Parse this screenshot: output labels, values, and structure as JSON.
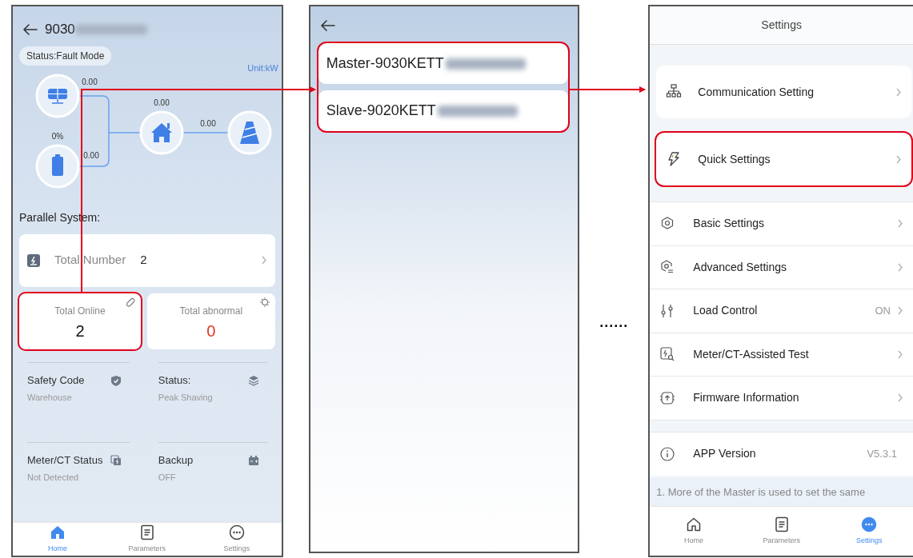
{
  "home_screen": {
    "title": "9030",
    "status": "Status:Fault Mode",
    "unit": "Unit:kW",
    "flow": {
      "solar_power": "0.00",
      "battery_soc": "0%",
      "battery_power": "0.00",
      "home_power": "0.00",
      "grid_power": "0.00"
    },
    "section_title": "Parallel System:",
    "total_number": {
      "label": "Total Number",
      "value": "2"
    },
    "stats": [
      {
        "label": "Total Online",
        "value": "2",
        "alert": false,
        "highlighted": true
      },
      {
        "label": "Total abnormal",
        "value": "0",
        "alert": true,
        "highlighted": false
      }
    ],
    "info": [
      {
        "label": "Safety Code",
        "value": "Warehouse"
      },
      {
        "label": "Status:",
        "value": "Peak Shaving"
      },
      {
        "label": "Meter/CT Status",
        "value": "Not Detected"
      },
      {
        "label": "Backup",
        "value": "OFF"
      }
    ],
    "tabs": [
      {
        "label": "Home",
        "selected": true
      },
      {
        "label": "Parameters",
        "selected": false
      },
      {
        "label": "Settings",
        "selected": false
      }
    ]
  },
  "device_list_screen": {
    "highlighted": true,
    "items": [
      {
        "label": "Master-9030KETT"
      },
      {
        "label": "Slave-9020KETT"
      }
    ]
  },
  "separator": "......",
  "settings_screen": {
    "title": "Settings",
    "groups": [
      {
        "kind": "card",
        "items": [
          {
            "label": "Communication Setting",
            "highlighted": false
          }
        ]
      },
      {
        "kind": "card",
        "items": [
          {
            "label": "Quick Settings",
            "highlighted": true
          }
        ]
      },
      {
        "kind": "list",
        "items": [
          {
            "label": "Basic Settings"
          },
          {
            "label": "Advanced Settings"
          },
          {
            "label": "Load Control",
            "value": "ON"
          },
          {
            "label": "Meter/CT-Assisted Test"
          },
          {
            "label": "Firmware Information"
          }
        ]
      },
      {
        "kind": "info",
        "items": [
          {
            "label": "APP Version",
            "value": "V5.3.1"
          }
        ]
      }
    ],
    "note": "1. More of the Master is used to set the same",
    "tabs": [
      {
        "label": "Home",
        "selected": false
      },
      {
        "label": "Parameters",
        "selected": false
      },
      {
        "label": "Settings",
        "selected": true
      }
    ]
  }
}
